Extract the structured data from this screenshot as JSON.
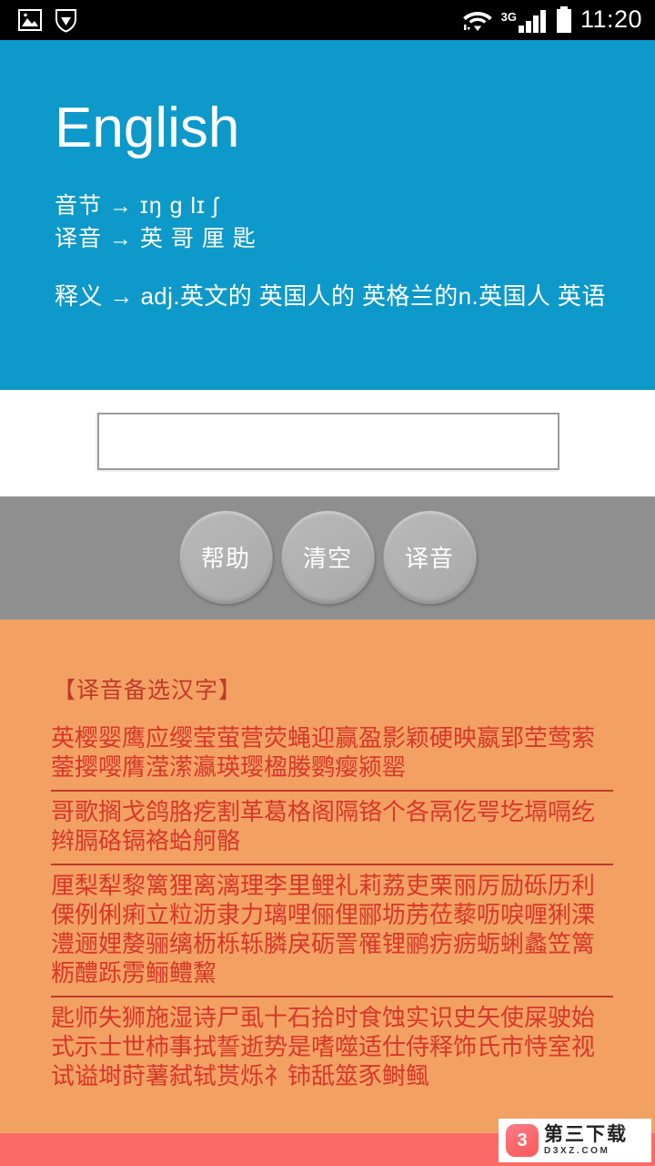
{
  "statusbar": {
    "time": "11:20",
    "network_label": "3G",
    "icons": [
      "image-icon",
      "shield-icon",
      "wifi-icon",
      "signal-icon",
      "battery-icon"
    ]
  },
  "header": {
    "title": "English",
    "syllable_line": "音节 → ɪŋ g lɪ ʃ",
    "transliteration_line": "译音 → 英 哥 厘 匙",
    "definition_line": "释义 → adj.英文的 英国人的 英格兰的n.英国人 英语",
    "background_color": "#0d99c9"
  },
  "input": {
    "value": "",
    "placeholder": ""
  },
  "buttons": [
    {
      "label": "帮助",
      "name": "help"
    },
    {
      "label": "清空",
      "name": "clear"
    },
    {
      "label": "译音",
      "name": "transliterate"
    }
  ],
  "results": {
    "title": "【译音备选汉字】",
    "title_color": "#c0392b",
    "background_color": "#f2a163",
    "text_color": "#d8372a",
    "groups": [
      "英樱婴鹰应缨莹萤营荧蝇迎赢盈影颖硬映嬴郢茔莺萦蓥撄嘤膺滢潆瀛瑛璎楹媵鹦瘿颍罂",
      "哥歌搁戈鸽胳疙割革葛格阁隔铬个各鬲仡咢圪塥嗝纥辫膈硌镉袼蛤舸骼",
      "厘梨犁黎篱狸离漓理李里鲤礼莉荔吏栗丽厉励砾历利傈例俐痢立粒沥隶力璃哩俪俚郦坜苈莅藜呖唳喱猁溧澧逦娌嫠骊缡枥栎轹膦戾砺詈罹锂鹂疠疬蛎蜊蠡笠篱粝醴跞雳鲡鳢黧",
      "匙师失狮施湿诗尸虱十石拾时食蚀实识史矢使屎驶始式示士世柿事拭誓逝势是嗜噬适仕侍释饰氏市恃室视试谥埘莳薯弑轼贳烁礻铈舐筮豕鲥鲺"
    ]
  },
  "watermark": {
    "cn": "第三下载",
    "en": "D3XZ.COM",
    "mark": "3"
  },
  "bottom_bar": {
    "color": "#fb6a64"
  }
}
